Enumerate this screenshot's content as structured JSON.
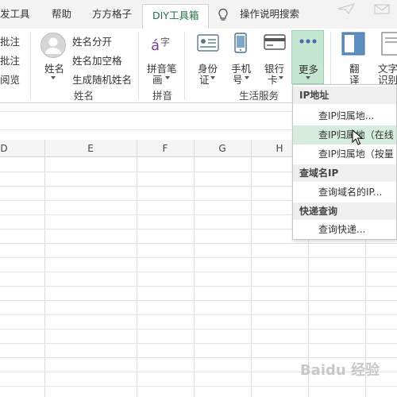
{
  "tabs": [
    {
      "label": "开发工具",
      "partial": "发工具",
      "active": false
    },
    {
      "label": "帮助",
      "active": false
    },
    {
      "label": "方方格子",
      "active": false
    },
    {
      "label": "DIY工具箱",
      "active": true
    },
    {
      "label": "操作说明搜索",
      "active": false
    }
  ],
  "ribbon": {
    "left_items": [
      "批注",
      "批注",
      "阅览"
    ],
    "name_button": "姓名",
    "name_group": {
      "items": [
        "姓名分开",
        "姓名加空格",
        "生成随机姓名"
      ],
      "label": "姓名"
    },
    "pinyin_group": {
      "button_line1": "拼音笔",
      "button_line2": "画",
      "label": "拼音"
    },
    "life_group": {
      "buttons": [
        {
          "line1": "身份",
          "line2": "证"
        },
        {
          "line1": "手机",
          "line2": "号"
        },
        {
          "line1": "银行",
          "line2": "卡"
        }
      ],
      "more": "更多",
      "label": "生活服务"
    },
    "right_buttons": [
      {
        "line1": "翻",
        "line2": "译"
      },
      {
        "line1": "文字",
        "line2": "识别"
      }
    ]
  },
  "columns": [
    "D",
    "E",
    "F",
    "G",
    "H"
  ],
  "menu": {
    "sections": [
      {
        "header": "IP地址",
        "items": [
          "查IP归属地...",
          "查IP归属地（在线",
          "查IP归属地（按量"
        ]
      },
      {
        "header": "查域名IP",
        "items": [
          "查询域名的IP..."
        ]
      },
      {
        "header": "快递查询",
        "items": [
          "查询快递..."
        ]
      }
    ],
    "hover_index": 1
  },
  "watermark": "Baidu 经验",
  "colors": {
    "accent": "#217346",
    "hover": "#d6ecdf",
    "more_bg": "#c5e7d2"
  }
}
